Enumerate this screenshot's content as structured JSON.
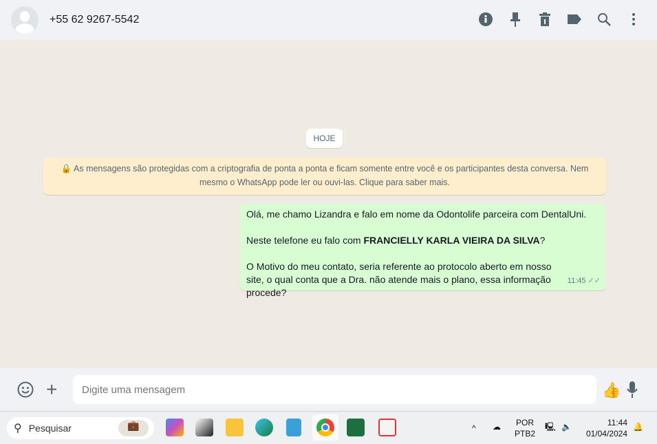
{
  "header": {
    "title": "+55 62 9267-5542",
    "icons": [
      "info-icon",
      "pin-icon",
      "delete-icon",
      "label-icon",
      "search-icon",
      "menu-icon"
    ]
  },
  "chat": {
    "date_chip": "HOJE",
    "encryption_notice": "🔒 As mensagens são protegidas com a criptografia de ponta a ponta e ficam somente entre você e os participantes desta conversa. Nem mesmo o WhatsApp pode ler ou ouvi-las. Clique para saber mais.",
    "message": {
      "line1": "Olá, me chamo Lizandra e falo em nome da Odontolife parceira com DentalUni.",
      "line2_prefix": "Neste telefone eu falo com ",
      "line2_bold": "FRANCIELLY KARLA VIEIRA DA SILVA",
      "line2_suffix": "?",
      "line3": "O Motivo do meu contato, seria referente ao protocolo aberto em nosso site, o qual conta que a Dra. não atende mais o plano, essa informação procede?",
      "time": "11:45",
      "status": "✓✓"
    }
  },
  "composer": {
    "placeholder": "Digite uma mensagem"
  },
  "taskbar": {
    "search": "Pesquisar",
    "lang1": "POR",
    "lang2": "PTB2",
    "time": "11:44",
    "date": "01/04/2024",
    "apps": [
      "copilot",
      "task-view",
      "file-explorer",
      "edge",
      "notepad",
      "chrome",
      "excel",
      "snipping-tool"
    ]
  }
}
